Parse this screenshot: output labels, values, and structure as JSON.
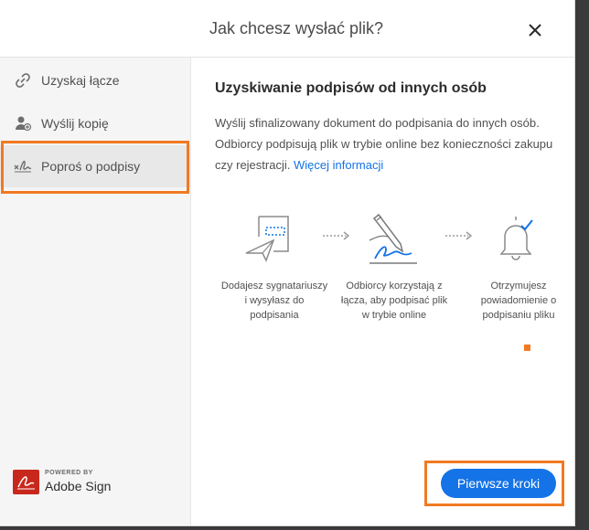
{
  "dialog": {
    "title": "Jak chcesz wysłać plik?",
    "close_icon": "close-icon"
  },
  "sidebar": {
    "items": [
      {
        "label": "Uzyskaj łącze",
        "icon": "link-icon"
      },
      {
        "label": "Wyślij kopię",
        "icon": "user-add-icon"
      },
      {
        "label": "Poproś o podpisy",
        "icon": "signature-icon",
        "active": true
      }
    ],
    "brand": {
      "powered": "POWERED BY",
      "name": "Adobe Sign"
    }
  },
  "main": {
    "heading": "Uzyskiwanie podpisów od innych osób",
    "description": "Wyślij sfinalizowany dokument do podpisania do innych osób. Odbiorcy podpisują plik w trybie online bez konieczności zakupu czy rejestracji.",
    "more_link": "Więcej informacji",
    "steps": [
      {
        "icon": "send-document-icon",
        "caption": "Dodajesz sygnatariuszy i wysyłasz do podpisania"
      },
      {
        "icon": "sign-pen-icon",
        "caption": "Odbiorcy korzystają z łącza, aby podpisać plik w trybie online"
      },
      {
        "icon": "notification-bell-icon",
        "caption": "Otrzymujesz powiadomienie o podpisaniu pliku"
      }
    ]
  },
  "footer": {
    "primary_button": "Pierwsze kroki"
  },
  "colors": {
    "accent": "#1473e6",
    "highlight": "#f07a22",
    "brand": "#c8281c"
  }
}
